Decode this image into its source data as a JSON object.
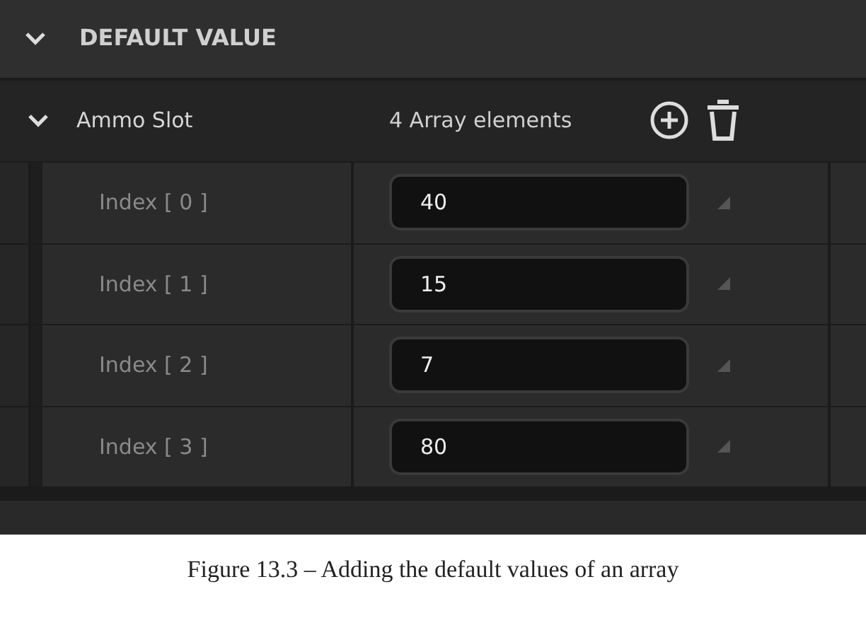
{
  "section": {
    "title": "DEFAULT VALUE",
    "expanded": true
  },
  "array": {
    "name": "Ammo Slot",
    "expanded": true,
    "summary": "4 Array elements"
  },
  "elements": [
    {
      "label": "Index [ 0 ]",
      "value": "40"
    },
    {
      "label": "Index [ 1 ]",
      "value": "15"
    },
    {
      "label": "Index [ 2 ]",
      "value": "7"
    },
    {
      "label": "Index [ 3 ]",
      "value": "80"
    }
  ],
  "caption": "Figure 13.3 – Adding the default values of an array"
}
